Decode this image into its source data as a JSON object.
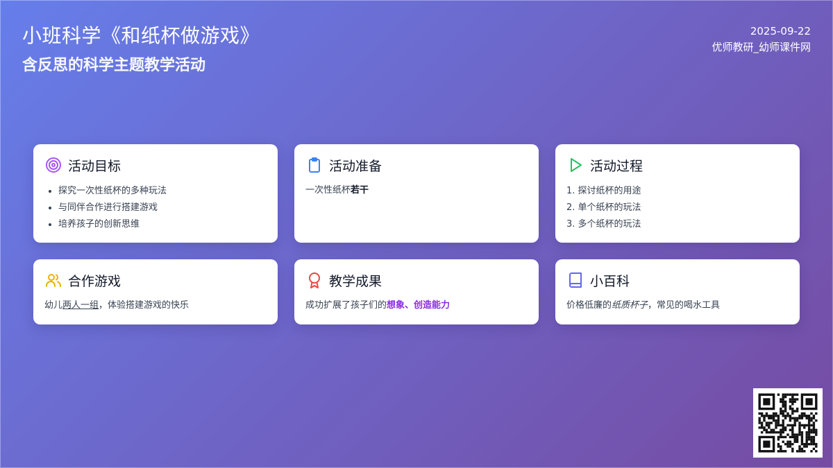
{
  "header": {
    "title": "小班科学《和纸杯做游戏》",
    "subtitle": "含反思的科学主题教学活动",
    "date": "2025-09-22",
    "source": "优师教研_幼师课件网"
  },
  "cards": {
    "goals": {
      "title": "活动目标",
      "icon": "target-icon",
      "items": [
        "探究一次性纸杯的多种玩法",
        "与同伴合作进行搭建游戏",
        "培养孩子的创新思维"
      ]
    },
    "prep": {
      "title": "活动准备",
      "icon": "clipboard-icon",
      "text_plain": "一次性纸杯",
      "text_bold": "若干"
    },
    "process": {
      "title": "活动过程",
      "icon": "play-icon",
      "items": [
        "1. 探讨纸杯的用途",
        "2. 单个纸杯的玩法",
        "3. 多个纸杯的玩法"
      ]
    },
    "coop": {
      "title": "合作游戏",
      "icon": "users-icon",
      "text_before": "幼儿",
      "text_underlined": "两人一组",
      "text_after": "，体验搭建游戏的快乐"
    },
    "results": {
      "title": "教学成果",
      "icon": "award-icon",
      "text_before": "成功扩展了孩子们的",
      "text_highlight": "想象、创造能力"
    },
    "wiki": {
      "title": "小百科",
      "icon": "book-icon",
      "text_before": "价格低廉的",
      "text_italic": "纸质杯子",
      "text_after": "，常见的喝水工具"
    }
  },
  "colors": {
    "gradient_start": "#667eea",
    "gradient_end": "#764ba2",
    "target_icon": "#a855f7",
    "clipboard_icon": "#3b82f6",
    "play_icon": "#22c55e",
    "users_icon": "#eab308",
    "award_icon": "#ef4444",
    "book_icon": "#6366f1",
    "highlight_text": "#8a2be2"
  }
}
